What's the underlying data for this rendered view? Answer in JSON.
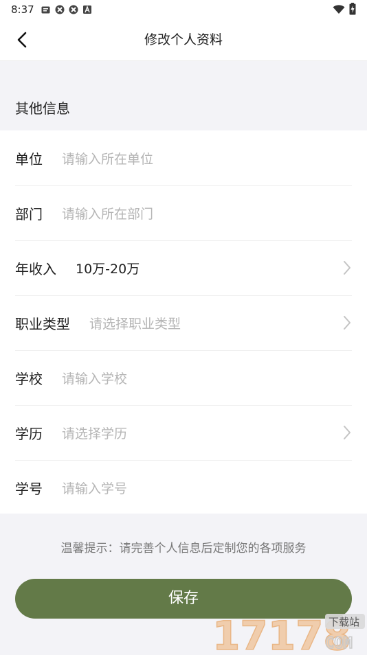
{
  "status": {
    "time": "8:37"
  },
  "header": {
    "title": "修改个人资料"
  },
  "section": {
    "title": "其他信息"
  },
  "form": {
    "rows": [
      {
        "label": "单位",
        "value": "请输入所在单位"
      },
      {
        "label": "部门",
        "value": "请输入所在部门"
      },
      {
        "label": "年收入",
        "value": "10万-20万"
      },
      {
        "label": "职业类型",
        "value": "请选择职业类型"
      },
      {
        "label": "学校",
        "value": "请输入学校"
      },
      {
        "label": "学历",
        "value": "请选择学历"
      },
      {
        "label": "学号",
        "value": "请输入学号"
      }
    ]
  },
  "tip": "温馨提示：请完善个人信息后定制您的各项服务",
  "save_label": "保存",
  "watermark": {
    "number": "17178",
    "domain": "COM",
    "tag": "下载站"
  },
  "colors": {
    "accent": "#637a48",
    "background": "#f3f3f7",
    "placeholder": "#b5b5b5"
  }
}
